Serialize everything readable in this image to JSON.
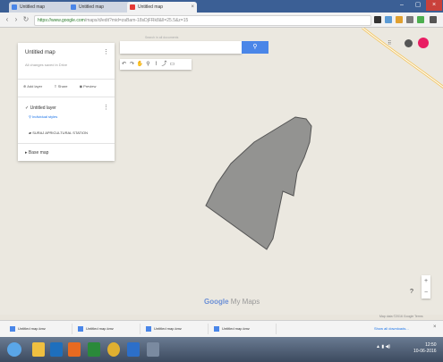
{
  "browser": {
    "tabs": [
      {
        "label": "Untitled map",
        "active": false,
        "icon": "maps-favicon-icon"
      },
      {
        "label": "Untitled map",
        "active": false,
        "icon": "maps-favicon-icon"
      },
      {
        "label": "Untitled map",
        "active": true,
        "icon": "maps-favicon-icon"
      }
    ],
    "url_host": "https://www.google.com",
    "url_path": "/maps/d/edit?mid=zaBam-18sDjFRk8&ll=25.5&z=15",
    "colors": {
      "tabstrip": "#3b5f95",
      "accent_blue": "#4a86e8",
      "avatar": "#e91e63"
    }
  },
  "map_panel": {
    "title": "Untitled map",
    "description": "All changes saved in Drive",
    "actions": {
      "add_layer": "Add layer",
      "share": "Share",
      "preview": "Preview"
    },
    "layer": {
      "title": "Untitled layer",
      "import_link": "Individual styles",
      "feature": "SURAJ APRICULTURAL STATION"
    },
    "base_map": "Base map"
  },
  "search": {
    "hint": "Search in all documents"
  },
  "controls": {
    "zoom_in": "+",
    "zoom_out": "−",
    "help": "?"
  },
  "watermark": {
    "brand": "Google",
    "product": "My Maps"
  },
  "map_data_text": "Map data ©2016 Google  Terms",
  "map_colors": {
    "background": "#ebe8e0",
    "polygon_fill": "#939391",
    "polygon_stroke": "#555555"
  },
  "downloads": {
    "items": [
      "Untitled map.kmz",
      "Untitled map.kmz",
      "Untitled map.kmz",
      "Untitled map.kmz"
    ],
    "show_all": "Show all downloads..."
  },
  "taskbar": {
    "clock_time": "12:50",
    "clock_date": "10-06-2016"
  }
}
